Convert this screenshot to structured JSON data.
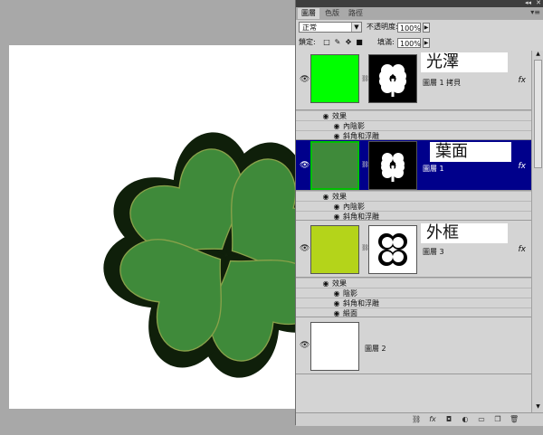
{
  "panel": {
    "tabs": [
      {
        "label": "圖層",
        "active": true
      },
      {
        "label": "色版",
        "active": false
      },
      {
        "label": "路徑",
        "active": false
      }
    ],
    "blend_mode": "正常",
    "opacity_label": "不透明度:",
    "opacity_value": "100%",
    "lock_label": "鎖定:",
    "fill_label": "填滿:",
    "fill_value": "100%"
  },
  "layers": [
    {
      "name": "圖層 1 拷貝",
      "annotation": "光澤",
      "thumb_color": "#00ff00",
      "selected": false,
      "fx": "fx",
      "effects_label": "效果",
      "effects": [
        "內陰影",
        "斜角和浮雕"
      ]
    },
    {
      "name": "圖層 1",
      "annotation": "葉面",
      "thumb_color": "#3f8a3a",
      "selected": true,
      "fx": "fx",
      "effects_label": "效果",
      "effects": [
        "內陰影",
        "斜角和浮雕"
      ]
    },
    {
      "name": "圖層 3",
      "annotation": "外框",
      "thumb_color": "#b4d41a",
      "selected": false,
      "fx": "fx",
      "effects_label": "效果",
      "effects": [
        "陰影",
        "斜角和浮雕",
        "緞面"
      ]
    },
    {
      "name": "圖層 2",
      "thumb_color": "#ffffff",
      "selected": false
    }
  ],
  "colors": {
    "leaf_fill": "#3f8a3a",
    "leaf_outline": "#0f1f0a",
    "selection": "#00008b"
  }
}
